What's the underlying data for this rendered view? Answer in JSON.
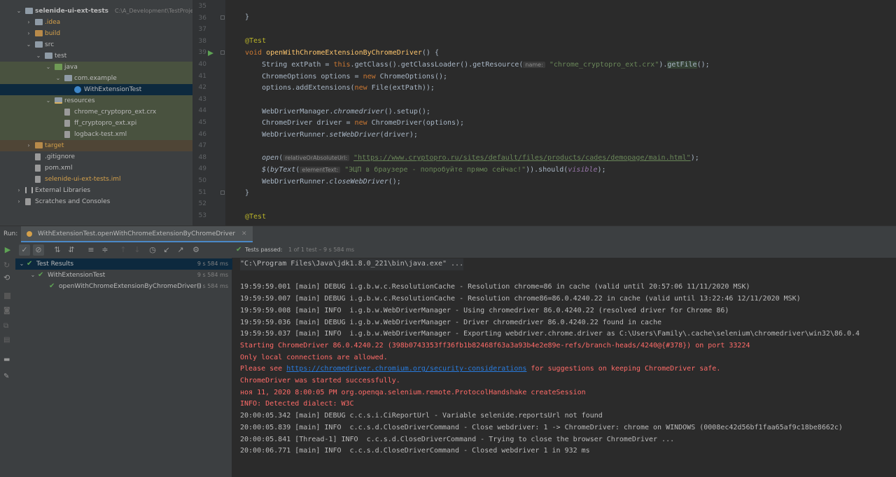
{
  "project_tree": [
    {
      "label": "selenide-ui-ext-tests",
      "path": "C:\\A_Development\\TestProject\\Gi",
      "depth": 0,
      "expanded": true,
      "icon": "folder"
    },
    {
      "label": ".idea",
      "depth": 1,
      "expanded": false,
      "icon": "folder",
      "color": "orange"
    },
    {
      "label": "build",
      "depth": 1,
      "expanded": false,
      "icon": "folder-orange",
      "color": "orange"
    },
    {
      "label": "src",
      "depth": 1,
      "expanded": true,
      "icon": "folder"
    },
    {
      "label": "test",
      "depth": 2,
      "expanded": true,
      "icon": "folder"
    },
    {
      "label": "java",
      "depth": 3,
      "expanded": true,
      "icon": "folder-green"
    },
    {
      "label": "com.example",
      "depth": 4,
      "expanded": true,
      "icon": "folder"
    },
    {
      "label": "WithExtensionTest",
      "depth": 5,
      "icon": "class",
      "selected": true
    },
    {
      "label": "resources",
      "depth": 3,
      "expanded": true,
      "icon": "folder-res"
    },
    {
      "label": "chrome_cryptopro_ext.crx",
      "depth": 4,
      "icon": "file"
    },
    {
      "label": "ff_cryptopro_ext.xpi",
      "depth": 4,
      "icon": "file"
    },
    {
      "label": "logback-test.xml",
      "depth": 4,
      "icon": "file"
    },
    {
      "label": "target",
      "depth": 1,
      "expanded": false,
      "icon": "folder-orange",
      "color": "orange"
    },
    {
      "label": ".gitignore",
      "depth": 1,
      "icon": "file"
    },
    {
      "label": "pom.xml",
      "depth": 1,
      "icon": "file"
    },
    {
      "label": "selenide-ui-ext-tests.iml",
      "depth": 1,
      "icon": "file",
      "color": "orange"
    },
    {
      "label": "External Libraries",
      "depth": 0,
      "expanded": false,
      "icon": "lib"
    },
    {
      "label": "Scratches and Consoles",
      "depth": 0,
      "expanded": false,
      "icon": "file"
    }
  ],
  "editor": {
    "line_numbers": [
      "35",
      "36",
      "37",
      "38",
      "39",
      "40",
      "41",
      "42",
      "43",
      "44",
      "45",
      "46",
      "47",
      "48",
      "49",
      "50",
      "51",
      "52",
      "53"
    ],
    "lines": {
      "l35": "}",
      "l38_ann": "@Test",
      "l39_kw": "void",
      "l39_fn": "openWithChromeExtensionByChromeDriver",
      "l39_rest": "() {",
      "l40_a": "String extPath = ",
      "l40_kw": "this",
      "l40_b": ".getClass().getClassLoader().getResource(",
      "l40_hint": "name:",
      "l40_str": "\"chrome_cryptopro_ext.crx\"",
      "l40_c": ").",
      "l40_m": "getFile",
      "l40_d": "();",
      "l41_a": "ChromeOptions options = ",
      "l41_kw": "new",
      "l41_b": " ChromeOptions();",
      "l42_a": "options.addExtensions(",
      "l42_kw": "new",
      "l42_b": " File(extPath));",
      "l44_a": "WebDriverManager.",
      "l44_it": "chromedriver",
      "l44_b": "().setup();",
      "l45_a": "ChromeDriver driver = ",
      "l45_kw": "new",
      "l45_b": " ChromeDriver(options);",
      "l46_a": "WebDriverRunner.",
      "l46_it": "setWebDriver",
      "l46_b": "(driver);",
      "l48_it": "open",
      "l48_a": "(",
      "l48_hint": "relativeOrAbsoluteUrl:",
      "l48_str": "\"https://www.cryptopro.ru/sites/default/files/products/cades/demopage/main.html\"",
      "l48_b": ");",
      "l49_it": "$",
      "l49_a": "(",
      "l49_it2": "byText",
      "l49_b": "(",
      "l49_hint": "elementText:",
      "l49_str": "\"ЭЦП в браузере - попробуйте прямо сейчас!\"",
      "l49_c": ")).should(",
      "l49_purple": "visible",
      "l49_d": ");",
      "l50_a": "WebDriverRunner.",
      "l50_it": "closeWebDriver",
      "l50_b": "();",
      "l51": "}",
      "l53_ann": "@Test"
    }
  },
  "run": {
    "label": "Run:",
    "tab": "WithExtensionTest.openWithChromeExtensionByChromeDriver",
    "status_bold": "Tests passed:",
    "status_rest": "1 of 1 test – 9 s 584 ms",
    "results": [
      {
        "label": "Test Results",
        "time": "9 s 584 ms",
        "depth": 0
      },
      {
        "label": "WithExtensionTest",
        "time": "9 s 584 ms",
        "depth": 1
      },
      {
        "label": "openWithChromeExtensionByChromeDriver()",
        "time": "9 s 584 ms",
        "depth": 2
      }
    ],
    "console": [
      {
        "text": "\"C:\\Program Files\\Java\\jdk1.8.0_221\\bin\\java.exe\" ...",
        "type": "cmd"
      },
      {
        "text": "",
        "type": "normal"
      },
      {
        "text": "19:59:59.001 [main] DEBUG i.g.b.w.c.ResolutionCache - Resolution chrome=86 in cache (valid until 20:57:06 11/11/2020 MSK)",
        "type": "normal"
      },
      {
        "text": "19:59:59.007 [main] DEBUG i.g.b.w.c.ResolutionCache - Resolution chrome86=86.0.4240.22 in cache (valid until 13:22:46 12/11/2020 MSK)",
        "type": "normal"
      },
      {
        "text": "19:59:59.008 [main] INFO  i.g.b.w.WebDriverManager - Using chromedriver 86.0.4240.22 (resolved driver for Chrome 86)",
        "type": "normal"
      },
      {
        "text": "19:59:59.036 [main] DEBUG i.g.b.w.WebDriverManager - Driver chromedriver 86.0.4240.22 found in cache",
        "type": "normal"
      },
      {
        "text": "19:59:59.037 [main] INFO  i.g.b.w.WebDriverManager - Exporting webdriver.chrome.driver as C:\\Users\\Family\\.cache\\selenium\\chromedriver\\win32\\86.0.4",
        "type": "normal"
      },
      {
        "text": "Starting ChromeDriver 86.0.4240.22 (398b0743353ff36fb1b82468f63a3a93b4e2e89e-refs/branch-heads/4240@{#378}) on port 33224",
        "type": "err"
      },
      {
        "text": "Only local connections are allowed.",
        "type": "err"
      },
      {
        "text": "Please see ",
        "link": "https://chromedriver.chromium.org/security-considerations",
        "after": " for suggestions on keeping ChromeDriver safe.",
        "type": "err-link"
      },
      {
        "text": "ChromeDriver was started successfully.",
        "type": "err"
      },
      {
        "text": "ноя 11, 2020 8:00:05 PM org.openqa.selenium.remote.ProtocolHandshake createSession",
        "type": "err"
      },
      {
        "text": "INFO: Detected dialect: W3C",
        "type": "err"
      },
      {
        "text": "20:00:05.342 [main] DEBUG c.c.s.i.CiReportUrl - Variable selenide.reportsUrl not found",
        "type": "normal"
      },
      {
        "text": "20:00:05.839 [main] INFO  c.c.s.d.CloseDriverCommand - Close webdriver: 1 -> ChromeDriver: chrome on WINDOWS (0008ec42d56bf1faa65af9c18be8662c)",
        "type": "normal"
      },
      {
        "text": "20:00:05.841 [Thread-1] INFO  c.c.s.d.CloseDriverCommand - Trying to close the browser ChromeDriver ...",
        "type": "normal"
      },
      {
        "text": "20:00:06.771 [main] INFO  c.c.s.d.CloseDriverCommand - Closed webdriver 1 in 932 ms",
        "type": "normal"
      }
    ]
  },
  "colors": {
    "keyword": "#cc7832",
    "annotation": "#bbb529",
    "method": "#ffc66d",
    "string": "#6a8759",
    "error": "#ff6b68",
    "link": "#287bde",
    "pass": "#5ea254"
  }
}
